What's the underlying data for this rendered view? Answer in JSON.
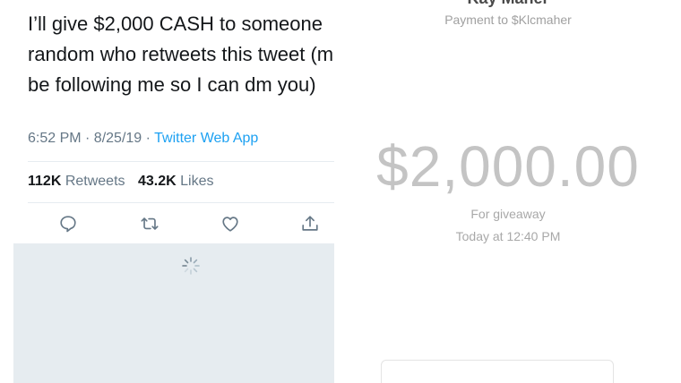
{
  "tweet": {
    "text_lines": [
      "I’ll give $2,000 CASH to someone",
      "random who retweets this tweet (mu",
      "be following me so I can dm you)"
    ],
    "time": "6:52 PM · 8/25/19 · ",
    "source": "Twitter Web App",
    "retweets_count": "112K",
    "retweets_label": "Retweets",
    "likes_count": "43.2K",
    "likes_label": "Likes",
    "icons": {
      "reply": "reply-icon",
      "retweet": "retweet-icon",
      "like": "heart-icon",
      "share": "share-icon",
      "loading": "loading-spinner-icon"
    },
    "colors": {
      "text": "#14171a",
      "muted": "#657786",
      "link": "#1da1f2",
      "loader_bg": "#e6ecf0"
    }
  },
  "payment": {
    "name": "Kay Maher",
    "to": "Payment to $Klcmaher",
    "amount": "$2,000.00",
    "note": "For giveaway",
    "time": "Today at 12:40 PM",
    "colors": {
      "amount": "#c4c4c4",
      "muted": "#a8a8a8"
    }
  }
}
